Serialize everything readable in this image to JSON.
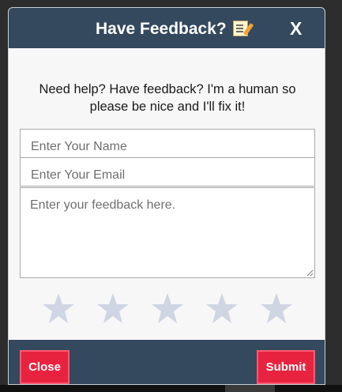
{
  "header": {
    "title": "Have Feedback?",
    "title_icon": "memo-icon",
    "close_label": "X"
  },
  "intro_text": "Need help? Have feedback? I'm a human so please be nice and I'll fix it!",
  "form": {
    "name_placeholder": "Enter Your Name",
    "name_value": "",
    "email_placeholder": "Enter Your Email",
    "email_value": "",
    "feedback_placeholder": "Enter your feedback here.",
    "feedback_value": ""
  },
  "rating": {
    "max_stars": 5,
    "selected": 0,
    "star_color": "#cfd5e3"
  },
  "footer": {
    "close_label": "Close",
    "submit_label": "Submit"
  },
  "colors": {
    "header_bg": "#34495e",
    "button_bg": "#e8233f",
    "modal_bg": "#f7f7f8"
  }
}
